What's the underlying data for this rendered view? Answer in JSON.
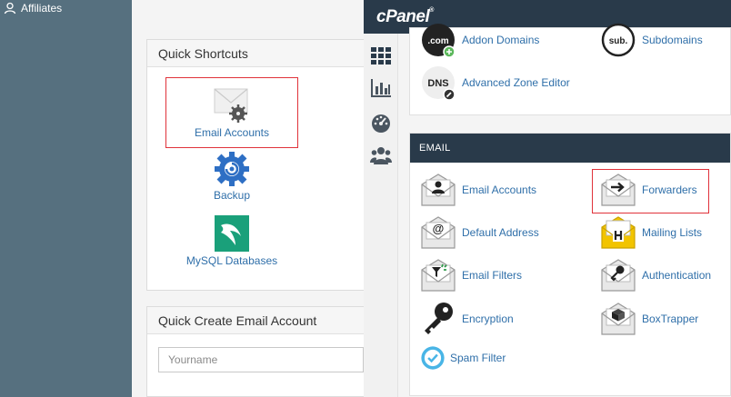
{
  "sidebar": {
    "items": [
      {
        "label": "Affiliates",
        "icon": "user-icon"
      }
    ]
  },
  "quick_shortcuts": {
    "title": "Quick Shortcuts",
    "items": [
      {
        "label": "Email Accounts",
        "icon": "mail-gear-icon",
        "highlighted": true
      },
      {
        "label": "Backup",
        "icon": "backup-gear-icon"
      },
      {
        "label": "MySQL Databases",
        "icon": "mysql-dolphin-icon"
      }
    ]
  },
  "quick_create": {
    "title": "Quick Create Email Account",
    "input_placeholder": "Yourname"
  },
  "cpanel": {
    "logo": "cPanel",
    "top_features": [
      {
        "label": "Addon Domains",
        "icon": "dotcom-icon"
      },
      {
        "label": "Subdomains",
        "icon": "sub-icon"
      },
      {
        "label": "Advanced Zone Editor",
        "icon": "dns-icon"
      }
    ],
    "email": {
      "title": "EMAIL",
      "features": [
        {
          "label": "Email Accounts",
          "icon": "email-accounts-icon"
        },
        {
          "label": "Forwarders",
          "icon": "forwarders-icon",
          "highlighted": true
        },
        {
          "label": "Default Address",
          "icon": "default-address-icon"
        },
        {
          "label": "Mailing Lists",
          "icon": "mailing-lists-icon"
        },
        {
          "label": "Email Filters",
          "icon": "email-filters-icon"
        },
        {
          "label": "Authentication",
          "icon": "authentication-icon"
        },
        {
          "label": "Encryption",
          "icon": "encryption-key-icon"
        },
        {
          "label": "BoxTrapper",
          "icon": "boxtrapper-icon"
        },
        {
          "label": "Spam Filter",
          "icon": "spam-filter-icon"
        }
      ]
    },
    "rail": [
      "grid-icon",
      "stats-icon",
      "dashboard-icon",
      "users-icon"
    ]
  },
  "colors": {
    "highlight": "#e0323a",
    "link": "#2f6fa9",
    "header": "#293a4a",
    "sidebar": "#56707f"
  }
}
